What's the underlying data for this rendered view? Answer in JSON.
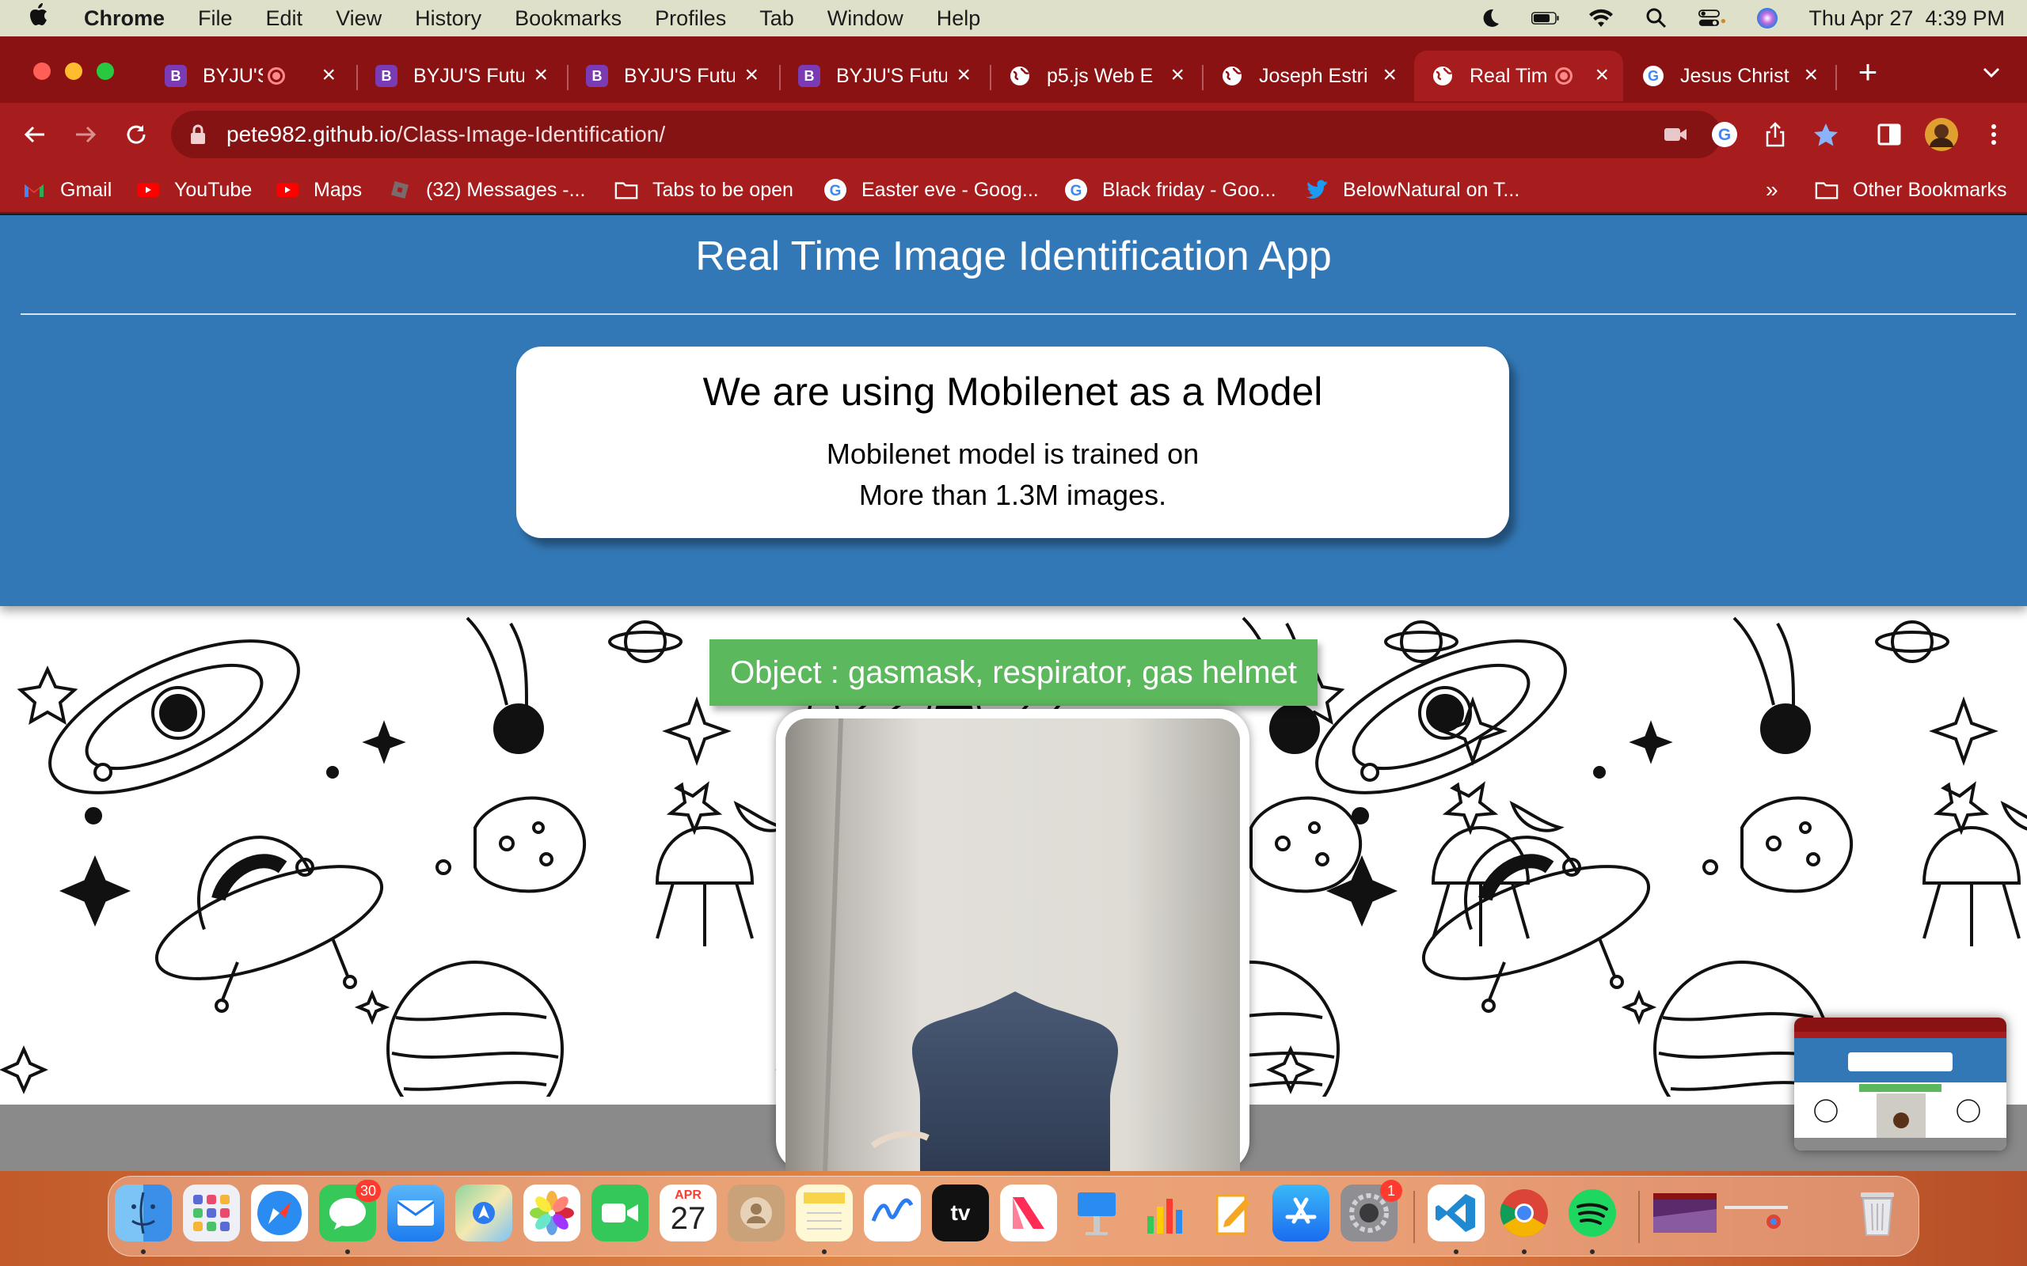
{
  "menubar": {
    "app_name": "Chrome",
    "items": [
      "File",
      "Edit",
      "View",
      "History",
      "Bookmarks",
      "Profiles",
      "Tab",
      "Window",
      "Help"
    ],
    "clock": "Thu Apr 27  4:39 PM"
  },
  "tabs": [
    {
      "title": "BYJU'S |",
      "favicon": "byjus-icon",
      "recording": true
    },
    {
      "title": "BYJU'S Futu",
      "favicon": "byjus-icon"
    },
    {
      "title": "BYJU'S Futu",
      "favicon": "byjus-icon"
    },
    {
      "title": "BYJU'S Futu",
      "favicon": "byjus-icon"
    },
    {
      "title": "p5.js Web E",
      "favicon": "globe-icon"
    },
    {
      "title": "Joseph Estri",
      "favicon": "globe-icon"
    },
    {
      "title": "Real Tim",
      "favicon": "globe-icon",
      "recording": true,
      "active": true
    },
    {
      "title": "Jesus Christ",
      "favicon": "google-icon"
    }
  ],
  "address_bar": {
    "host": "pete982.github.io",
    "path": "/Class-Image-Identification/"
  },
  "bookmarks": [
    {
      "label": "Gmail",
      "icon": "gmail-icon"
    },
    {
      "label": "YouTube",
      "icon": "youtube-icon"
    },
    {
      "label": "Maps",
      "icon": "youtube-icon"
    },
    {
      "label": "(32) Messages -...",
      "icon": "roblox-icon"
    },
    {
      "label": "Tabs to be open",
      "icon": "folder-icon"
    },
    {
      "label": "Easter eve - Goog...",
      "icon": "google-icon"
    },
    {
      "label": "Black friday - Goo...",
      "icon": "google-icon"
    },
    {
      "label": "BelowNatural on T...",
      "icon": "twitter-icon"
    }
  ],
  "bookmarks_overflow": "»",
  "other_bookmarks": "Other Bookmarks",
  "page": {
    "title": "Real Time Image Identification App",
    "card": {
      "heading": "We are using Mobilenet as a Model",
      "line1": "Mobilenet model is trained on",
      "line2": "More than 1.3M images."
    },
    "result": "Object : gasmask, respirator, gas helmet"
  },
  "dock": {
    "messages_badge": "30",
    "calendar_month": "APR",
    "calendar_day": "27",
    "settings_badge": "1",
    "apps": [
      "finder",
      "launchpad",
      "safari",
      "messages",
      "mail",
      "maps",
      "photos",
      "facetime",
      "calendar",
      "contacts",
      "notes",
      "freeform",
      "apple-tv",
      "news",
      "keynote",
      "numbers",
      "pages",
      "app-store",
      "system-settings",
      "vscode",
      "chrome",
      "spotify"
    ]
  },
  "colors": {
    "chrome_frame": "#8b1212",
    "chrome_toolbar": "#a71d1d",
    "page_header": "#3378b6",
    "result_green": "#5cb85c"
  }
}
